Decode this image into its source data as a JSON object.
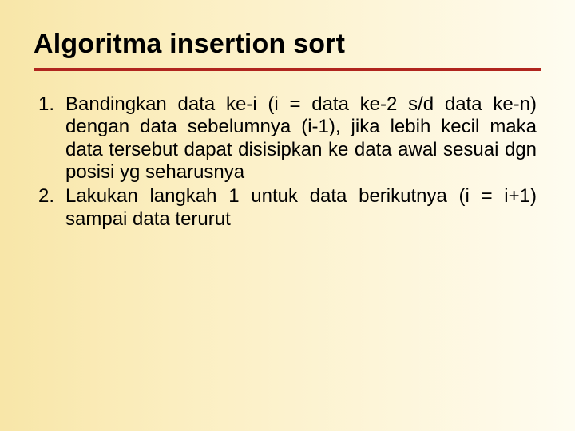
{
  "title": "Algoritma insertion sort",
  "steps": [
    "Bandingkan data ke-i (i = data ke-2 s/d data ke-n) dengan data sebelumnya (i-1), jika lebih kecil maka data tersebut dapat disisipkan ke data awal sesuai dgn posisi yg seharusnya",
    "Lakukan langkah 1 untuk data berikutnya (i = i+1) sampai data terurut"
  ]
}
